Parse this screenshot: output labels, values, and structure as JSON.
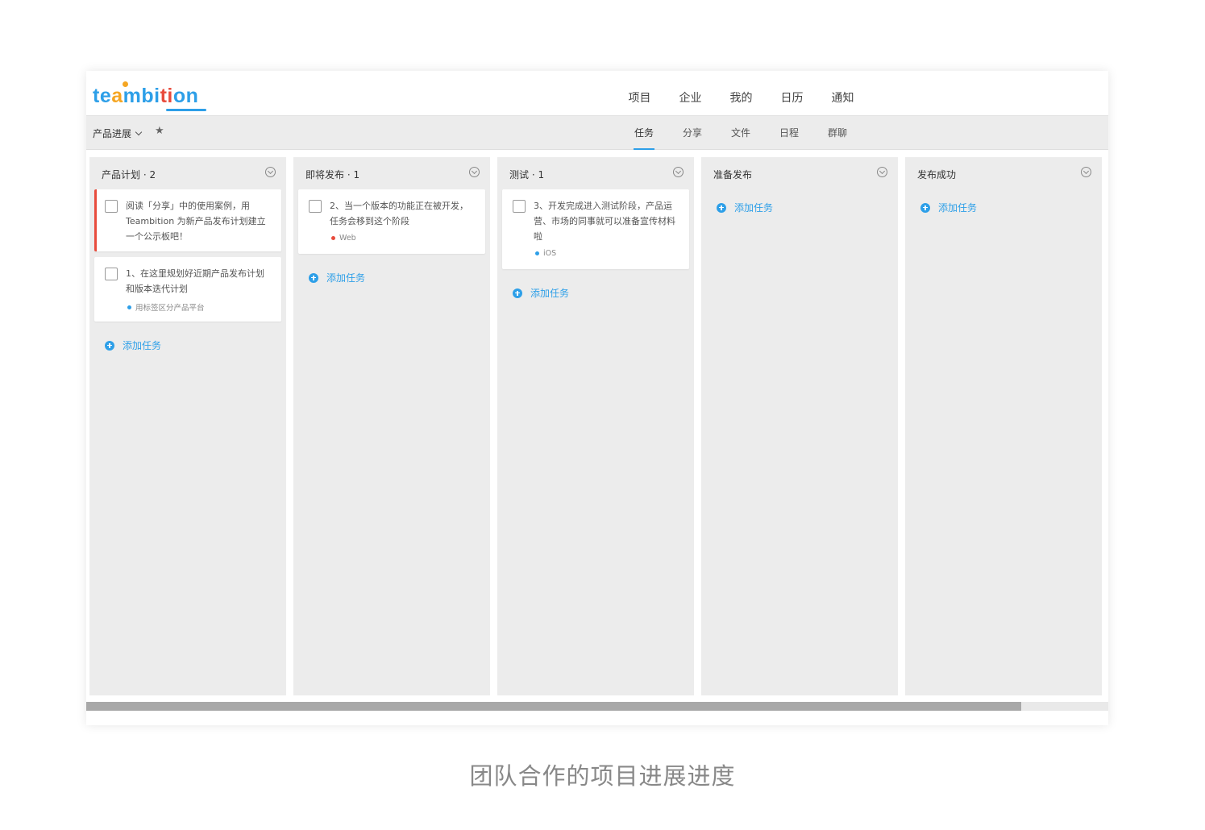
{
  "logo": {
    "letters": [
      "te",
      "a",
      "mbi",
      "ti",
      "on"
    ]
  },
  "topnav": [
    "项目",
    "企业",
    "我的",
    "日历",
    "通知"
  ],
  "project": {
    "name": "产品进展"
  },
  "subnav": {
    "items": [
      "任务",
      "分享",
      "文件",
      "日程",
      "群聊"
    ],
    "active": 0
  },
  "columns": [
    {
      "title": "产品计划 · 2",
      "cards": [
        {
          "text": "阅读「分享」中的使用案例，用 Teambition 为新产品发布计划建立一个公示板吧！",
          "tag": "",
          "tag_color": "",
          "flag": true
        },
        {
          "text": "1、在这里规划好近期产品发布计划和版本迭代计划",
          "tag": "用标签区分产品平台",
          "tag_color": "#2d9fe8",
          "flag": false
        }
      ],
      "add_label": "添加任务"
    },
    {
      "title": "即将发布 · 1",
      "cards": [
        {
          "text": "2、当一个版本的功能正在被开发，任务会移到这个阶段",
          "tag": "Web",
          "tag_color": "#e84b3c",
          "flag": false
        }
      ],
      "add_label": "添加任务"
    },
    {
      "title": "测试 · 1",
      "cards": [
        {
          "text": "3、开发完成进入测试阶段，产品运营、市场的同事就可以准备宣传材料啦",
          "tag": "iOS",
          "tag_color": "#2d9fe8",
          "flag": false
        }
      ],
      "add_label": "添加任务"
    },
    {
      "title": "准备发布",
      "cards": [],
      "add_label": "添加任务"
    },
    {
      "title": "发布成功",
      "cards": [],
      "add_label": "添加任务"
    }
  ],
  "scroll": {
    "position": 0.0,
    "visible_fraction": 0.915
  },
  "caption": "团队合作的项目进展进度",
  "colors": {
    "accent": "#2d9fe8",
    "flag": "#e84b3c"
  }
}
